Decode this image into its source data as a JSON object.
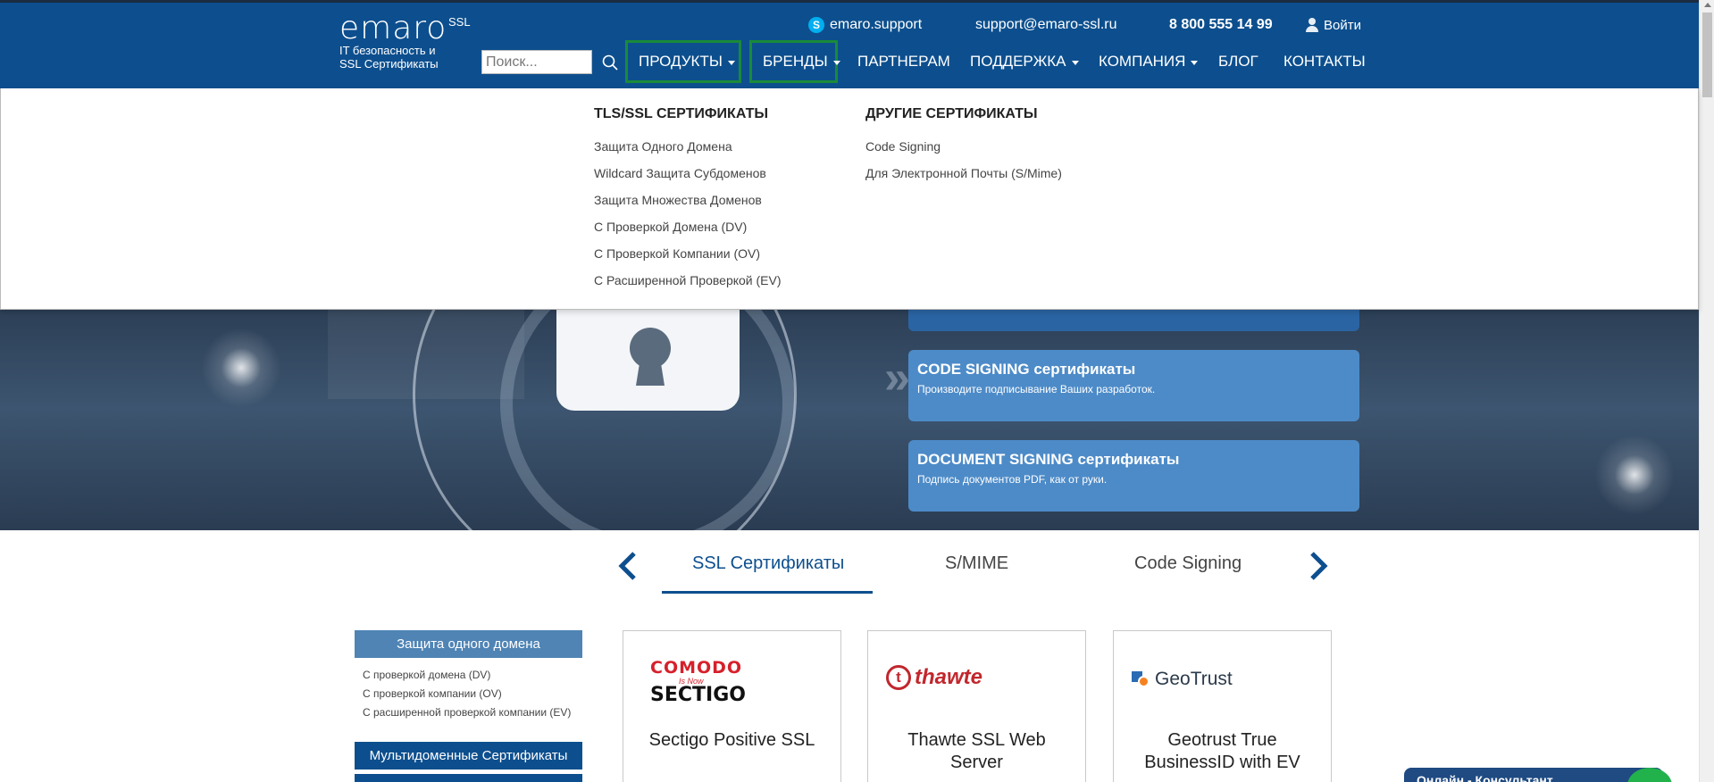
{
  "header": {
    "logo_word": "emaro",
    "logo_ssl": "SSL",
    "logo_sub_line1": "IT безопасность и",
    "logo_sub_line2": "SSL Сертификаты",
    "skype": "emaro.support",
    "email": "support@emaro-ssl.ru",
    "phone": "8 800 555 14 99",
    "login": "Войти",
    "search_placeholder": "Поиск..."
  },
  "nav": {
    "products": "ПРОДУКТЫ",
    "brands": "БРЕНДЫ",
    "partners": "ПАРТНЕРАМ",
    "support": "ПОДДЕРЖКА",
    "company": "КОМПАНИЯ",
    "blog": "БЛОГ",
    "contacts": "КОНТАКТЫ"
  },
  "dropdown": {
    "col1": {
      "heading": "TLS/SSL СЕРТИФИКАТЫ",
      "links": [
        "Защита Одного Домена",
        "Wildcard Защита Субдоменов",
        "Защита Множества Доменов",
        "С Проверкой Домена (DV)",
        "С Проверкой Компании (OV)",
        "С Расширенной Проверкой (EV)"
      ]
    },
    "col2": {
      "heading": "ДРУГИЕ СЕРТИФИКАТЫ",
      "links": [
        "Code Signing",
        "Для Электронной Почты (S/Mime)"
      ]
    }
  },
  "hero": {
    "cards": [
      {
        "title": "CODE SIGNING сертификаты",
        "desc": "Производите подписывание Ваших разработок."
      },
      {
        "title": "DOCUMENT SIGNING сертификаты",
        "desc": "Подпись документов PDF, как от руки."
      }
    ]
  },
  "tabs": [
    "SSL Сертификаты",
    "S/MIME",
    "Code Signing"
  ],
  "sidebar": {
    "header1": "Защита одного домена",
    "links": [
      "С проверкой домена (DV)",
      "С проверкой компании (OV)",
      "С расширенной проверкой компании (EV)"
    ],
    "header2": "Мультидоменные Сертификаты"
  },
  "products": [
    {
      "logo_line1": "COMODO",
      "logo_line2": "Is Now",
      "logo_line3": "SECTIGO",
      "title": "Sectigo Positive SSL"
    },
    {
      "logo_letter": "t",
      "logo_text": "thawte",
      "title": "Thawte SSL Web Server"
    },
    {
      "logo_text": "GeoTrust",
      "title": "Geotrust True BusinessID with EV"
    }
  ],
  "chat": {
    "label": "Онлайн - Консультант"
  },
  "colors": {
    "header_bg": "#0d4f8e",
    "nav_highlight": "#1a8a3a",
    "card_bg": "#4d8bc8"
  }
}
